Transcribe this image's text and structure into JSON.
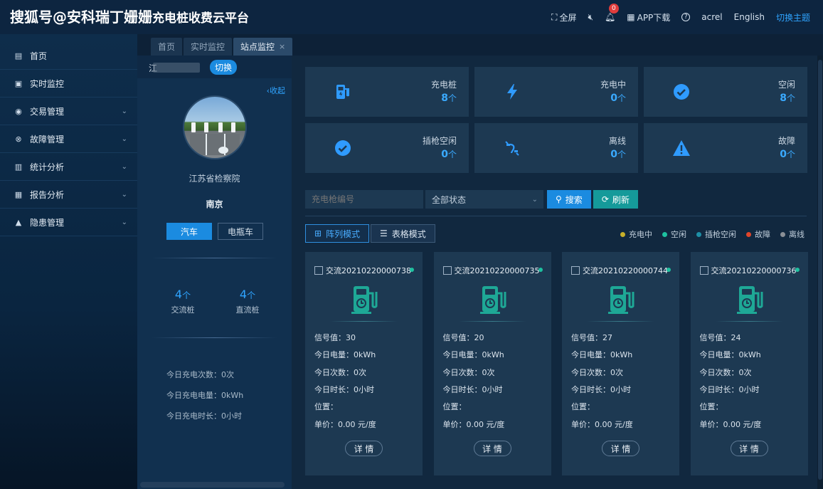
{
  "header": {
    "logo": "搜狐号@安科瑞丁姗姗",
    "title": "充电桩收费云平台",
    "fullscreen": "全屏",
    "mute_icon": "speaker-mute-icon",
    "notify_count": "0",
    "app_download": "APP下载",
    "help": "?",
    "user": "acrel",
    "language": "English",
    "theme": "切换主题"
  },
  "sidebar": {
    "items": [
      {
        "label": "首页",
        "icon": "home-icon",
        "glyph": "▤",
        "expand": false
      },
      {
        "label": "实时监控",
        "icon": "monitor-icon",
        "glyph": "▣",
        "expand": false
      },
      {
        "label": "交易管理",
        "icon": "trade-icon",
        "glyph": "◉",
        "expand": true
      },
      {
        "label": "故障管理",
        "icon": "fault-icon",
        "glyph": "⊗",
        "expand": true
      },
      {
        "label": "统计分析",
        "icon": "stats-icon",
        "glyph": "▥",
        "expand": true
      },
      {
        "label": "报告分析",
        "icon": "report-icon",
        "glyph": "▦",
        "expand": true
      },
      {
        "label": "隐患管理",
        "icon": "hazard-icon",
        "glyph": "▲",
        "expand": true
      }
    ]
  },
  "tabs": [
    {
      "label": "首页",
      "active": false
    },
    {
      "label": "实时监控",
      "active": false
    },
    {
      "label": "站点监控",
      "active": true
    }
  ],
  "station": {
    "name_prefix": "江",
    "switch_label": "切换",
    "collapse_label": "收起",
    "title": "江苏省检察院",
    "city": "南京",
    "vehicle_tabs": [
      "汽车",
      "电瓶车"
    ],
    "ac_count": "4",
    "dc_count": "4",
    "unit": "个",
    "ac_label": "交流桩",
    "dc_label": "直流桩",
    "today_times": "今日充电次数：0次",
    "today_energy": "今日充电电量：0kWh",
    "today_duration": "今日充电时长：0小时"
  },
  "stats": [
    {
      "label": "充电桩",
      "value": "8",
      "unit": "个",
      "icon": "charger-icon"
    },
    {
      "label": "充电中",
      "value": "0",
      "unit": "个",
      "icon": "lightning-icon"
    },
    {
      "label": "空闲",
      "value": "8",
      "unit": "个",
      "icon": "check-icon"
    },
    {
      "label": "插枪空闲",
      "value": "0",
      "unit": "个",
      "icon": "check-circle-icon"
    },
    {
      "label": "离线",
      "value": "0",
      "unit": "个",
      "icon": "unplug-icon"
    },
    {
      "label": "故障",
      "value": "0",
      "unit": "个",
      "icon": "warning-icon"
    }
  ],
  "filters": {
    "gun_placeholder": "充电枪编号",
    "status_value": "全部状态",
    "search_label": "搜索",
    "refresh_label": "刷新"
  },
  "modes": {
    "grid": "阵列模式",
    "table": "表格模式"
  },
  "legend": [
    {
      "label": "充电中",
      "color": "#c7b02a"
    },
    {
      "label": "空闲",
      "color": "#1ec1a0"
    },
    {
      "label": "插枪空闲",
      "color": "#1e8fa6"
    },
    {
      "label": "故障",
      "color": "#e0452a"
    },
    {
      "label": "离线",
      "color": "#8a8f96"
    }
  ],
  "cards": [
    {
      "code": "交流20210220000738",
      "signal": "信号值：30",
      "energy": "今日电量：0kWh",
      "times": "今日次数：0次",
      "duration": "今日时长：0小时",
      "location": "位置：",
      "price": "单价：0.00 元/度",
      "detail": "详 情"
    },
    {
      "code": "交流20210220000735",
      "signal": "信号值：20",
      "energy": "今日电量：0kWh",
      "times": "今日次数：0次",
      "duration": "今日时长：0小时",
      "location": "位置：",
      "price": "单价：0.00 元/度",
      "detail": "详 情"
    },
    {
      "code": "交流20210220000744",
      "signal": "信号值：27",
      "energy": "今日电量：0kWh",
      "times": "今日次数：0次",
      "duration": "今日时长：0小时",
      "location": "位置：",
      "price": "单价：0.00 元/度",
      "detail": "详 情"
    },
    {
      "code": "交流20210220000736",
      "signal": "信号值：24",
      "energy": "今日电量：0kWh",
      "times": "今日次数：0次",
      "duration": "今日时长：0小时",
      "location": "位置：",
      "price": "单价：0.00 元/度",
      "detail": "详 情"
    }
  ]
}
